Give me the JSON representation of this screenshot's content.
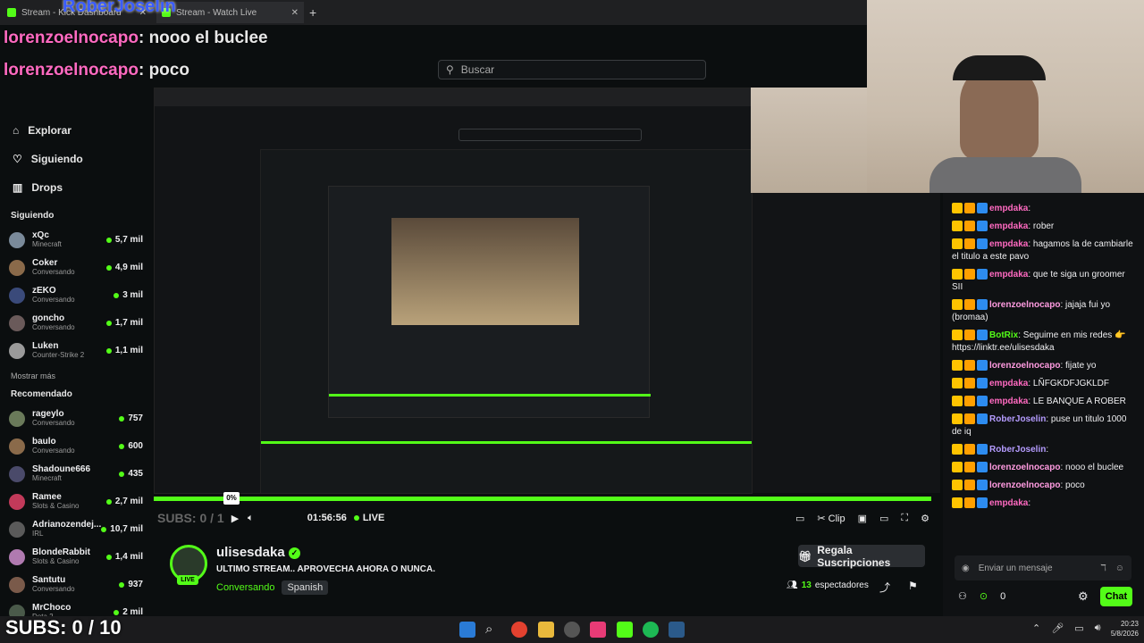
{
  "browser": {
    "tabs": [
      {
        "label": "Stream - Kick Dashboard"
      },
      {
        "label": "Stream - Watch Live"
      }
    ],
    "overlay_brand": "RoberJoselin"
  },
  "overlay_chat": [
    {
      "user": "lorenzoelnocapo",
      "text": "nooo el buclee"
    },
    {
      "user": "lorenzoelnocapo",
      "text": "poco"
    },
    {
      "user": "empdaka",
      "text": ""
    }
  ],
  "header": {
    "search_placeholder": "Buscar"
  },
  "sidebar": {
    "nav": [
      {
        "label": "Explorar",
        "icon": "compass-icon"
      },
      {
        "label": "Siguiendo",
        "icon": "heart-icon"
      },
      {
        "label": "Drops",
        "icon": "drops-icon"
      }
    ],
    "following_title": "Siguiendo",
    "following": [
      {
        "name": "xQc",
        "category": "Minecraft",
        "viewers": "5,7 mil",
        "color": "#7a8a9a"
      },
      {
        "name": "Coker",
        "category": "Conversando",
        "viewers": "4,9 mil",
        "color": "#8a6a4a"
      },
      {
        "name": "zEKO",
        "category": "Conversando",
        "viewers": "3 mil",
        "color": "#3a4a7a"
      },
      {
        "name": "goncho",
        "category": "Conversando",
        "viewers": "1,7 mil",
        "color": "#6a5a5a"
      },
      {
        "name": "Luken",
        "category": "Counter-Strike 2",
        "viewers": "1,1 mil",
        "color": "#9a9a9a"
      }
    ],
    "show_more": "Mostrar más",
    "recommended_title": "Recomendado",
    "recommended": [
      {
        "name": "rageylo",
        "category": "Conversando",
        "viewers": "757",
        "color": "#6a7a5a"
      },
      {
        "name": "baulo",
        "category": "Conversando",
        "viewers": "600",
        "color": "#8a6a4a"
      },
      {
        "name": "Shadoune666",
        "category": "Minecraft",
        "viewers": "435",
        "color": "#4a4a6a"
      },
      {
        "name": "Ramee",
        "category": "Slots & Casino",
        "viewers": "2,7 mil",
        "color": "#c23a5a"
      },
      {
        "name": "Adrianozendej...",
        "category": "IRL",
        "viewers": "10,7 mil",
        "color": "#5a5a5a"
      },
      {
        "name": "BlondeRabbit",
        "category": "Slots & Casino",
        "viewers": "1,4 mil",
        "color": "#b07ab0"
      },
      {
        "name": "Santutu",
        "category": "Conversando",
        "viewers": "937",
        "color": "#7a5a4a"
      },
      {
        "name": "MrChoco",
        "category": "Dota 2",
        "viewers": "2 mil",
        "color": "#4a5a4a"
      }
    ]
  },
  "player": {
    "subs_overlay": "SUBS: 0 / 10",
    "percent": "0%",
    "time": "01:56:56",
    "live_label": "LIVE",
    "clip_label": "Clip",
    "progress": 1.0
  },
  "stream": {
    "channel": "ulisesdaka",
    "title": "ULTIMO STREAM.. APROVECHA AHORA O NUNCA.",
    "category": "Conversando",
    "language": "Spanish",
    "live_badge": "LIVE",
    "gift_button": "Regala Suscripciones",
    "viewers_count": "13",
    "viewers_label": "espectadores"
  },
  "chat": {
    "messages": [
      {
        "user": "empdaka",
        "text": "",
        "user_color": "#ff6ac1"
      },
      {
        "user": "empdaka",
        "text": "rober",
        "user_color": "#ff6ac1"
      },
      {
        "user": "empdaka",
        "text": "hagamos la de cambiarle el titulo a este pavo",
        "user_color": "#ff6ac1"
      },
      {
        "user": "empdaka",
        "text": "que te siga un groomer SII",
        "user_color": "#ff6ac1"
      },
      {
        "user": "lorenzoelnocapo",
        "text": "jajaja fui yo (bromaa)",
        "user_color": "#ff9be0"
      },
      {
        "user": "BotRix",
        "text": "Seguime en mis redes 👉 https://linktr.ee/ulisesdaka",
        "user_color": "#53fc18"
      },
      {
        "user": "lorenzoelnocapo",
        "text": "fijate yo",
        "user_color": "#ff9be0"
      },
      {
        "user": "empdaka",
        "text": "LÑFGKDFJGKLDF",
        "user_color": "#ff6ac1"
      },
      {
        "user": "empdaka",
        "text": "LE BANQUE A ROBER",
        "user_color": "#ff6ac1"
      },
      {
        "user": "RoberJoselin",
        "text": "puse un titulo 1000 de iq",
        "user_color": "#b59cff"
      },
      {
        "user": "RoberJoselin",
        "text": "",
        "user_color": "#b59cff"
      },
      {
        "user": "lorenzoelnocapo",
        "text": "nooo el buclee",
        "user_color": "#ff9be0"
      },
      {
        "user": "lorenzoelnocapo",
        "text": "poco",
        "user_color": "#ff9be0"
      },
      {
        "user": "empdaka",
        "text": "",
        "user_color": "#ff6ac1"
      }
    ],
    "input_placeholder": "Enviar un mensaje",
    "points": "0",
    "send_label": "Chat"
  },
  "taskbar": {
    "time": "20:23",
    "date": "5/8/2026"
  },
  "colors": {
    "accent": "#53fc18",
    "pink_user": "#ff6ac1",
    "bg": "#0b0e0f"
  }
}
